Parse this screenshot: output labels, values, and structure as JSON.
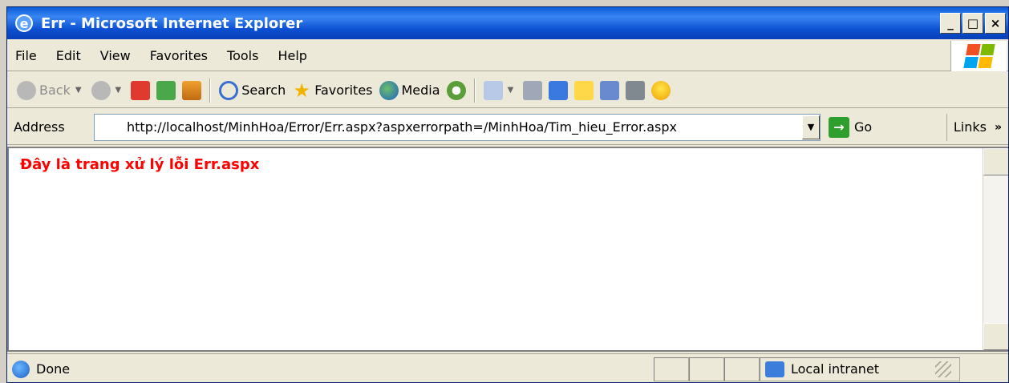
{
  "window": {
    "title": "Err - Microsoft Internet Explorer",
    "controls": {
      "minimize": "_",
      "maximize": "□",
      "close": "×"
    }
  },
  "menu": {
    "items": [
      "File",
      "Edit",
      "View",
      "Favorites",
      "Tools",
      "Help"
    ]
  },
  "toolbar": {
    "back": "Back",
    "search": "Search",
    "favorites": "Favorites",
    "media": "Media"
  },
  "address": {
    "label": "Address",
    "url": "http://localhost/MinhHoa/Error/Err.aspx?aspxerrorpath=/MinhHoa/Tim_hieu_Error.aspx",
    "go": "Go",
    "links": "Links",
    "links_more": "»"
  },
  "content": {
    "message": "Đây là trang xử lý lỗi Err.aspx",
    "message_color": "#ff0000"
  },
  "status": {
    "text": "Done",
    "zone": "Local intranet"
  },
  "icons": {
    "app": "ie-logo-icon",
    "back": "back-arrow-icon",
    "forward": "forward-arrow-icon",
    "stop": "stop-icon",
    "refresh": "refresh-icon",
    "home": "home-icon",
    "search": "search-icon",
    "favorites": "star-icon",
    "media": "media-icon",
    "history": "history-icon",
    "mail": "mail-icon",
    "print": "print-icon",
    "edit": "edit-icon",
    "messenger": "messenger-icon",
    "emoticon": "emoticon-icon"
  }
}
